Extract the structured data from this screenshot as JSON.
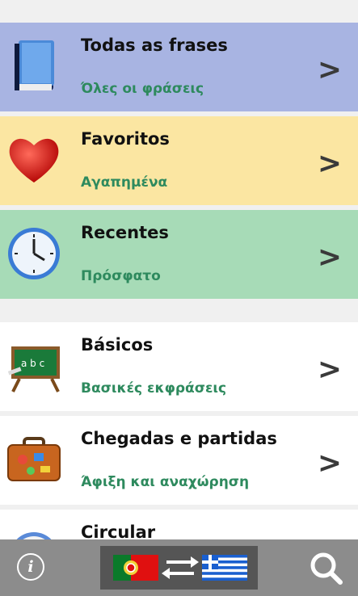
{
  "categories": [
    {
      "title": "Todas as frases",
      "subtitle": "Όλες οι φράσεις",
      "icon": "book-icon",
      "bg": "#a8b4e2"
    },
    {
      "title": "Favoritos",
      "subtitle": "Αγαπημένα",
      "icon": "heart-icon",
      "bg": "#fbe6a2"
    },
    {
      "title": "Recentes",
      "subtitle": "Πρόσφατο",
      "icon": "clock-icon",
      "bg": "#a7dbb7"
    },
    {
      "title": "Básicos",
      "subtitle": "Βασικές εκφράσεις",
      "icon": "chalkboard-icon",
      "bg": "#ffffff"
    },
    {
      "title": "Chegadas e partidas",
      "subtitle": "Άφιξη και αναχώρηση",
      "icon": "suitcase-icon",
      "bg": "#ffffff"
    },
    {
      "title": "Circular",
      "subtitle": "",
      "icon": "compass-icon",
      "bg": "#ffffff"
    }
  ],
  "chalkboard_text": "a b c",
  "chevron": ">",
  "bottom_bar": {
    "info_label": "i",
    "info_icon": "info-icon",
    "lang_from_flag": "portugal-flag-icon",
    "lang_to_flag": "greece-flag-icon",
    "swap_icon": "swap-arrows-icon",
    "search_icon": "search-icon"
  }
}
